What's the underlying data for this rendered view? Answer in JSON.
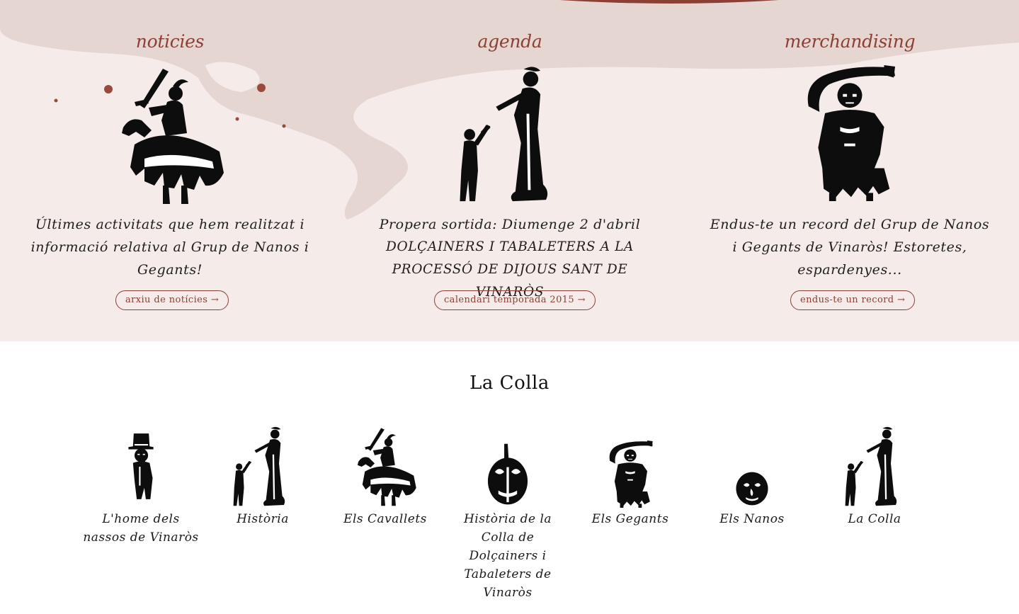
{
  "features": [
    {
      "title": "noticies",
      "figure": "knight-horse-icon",
      "text": "Últimes activitats que hem realitzat i informació relativa al Grup de Nanos i Gegants!",
      "button": "arxiu de notícies →"
    },
    {
      "title": "agenda",
      "figure": "musician-child-icon",
      "text_line1": "Propera sortida: Diumenge 2 d'abril",
      "text_line2": "DOLÇAINERS I TABALETERS A LA PROCESSÓ DE DIJOUS SANT DE VINARÒS",
      "button": "calendari temporada 2015 →"
    },
    {
      "title": "merchandising",
      "figure": "giant-scarf-icon",
      "text": "Endus-te un record del Grup de Nanos i Gegants de Vinaròs! Estoretes, espardenyes...",
      "button": "endus-te un record →"
    }
  ],
  "colla": {
    "title": "La Colla",
    "items": [
      {
        "label": "L'home dels nassos de Vinaròs",
        "icon": "top-hat-man-icon"
      },
      {
        "label": "Història",
        "icon": "musician-child-icon"
      },
      {
        "label": "Els Cavallets",
        "icon": "knight-horse-icon"
      },
      {
        "label": "Història de la Colla de Dolçainers i Tabaleters de Vinaròs",
        "icon": "drum-icon"
      },
      {
        "label": "Els Gegants",
        "icon": "giant-scarf-icon"
      },
      {
        "label": "Els Nanos",
        "icon": "nano-head-icon"
      },
      {
        "label": "La Colla",
        "icon": "musician-child-icon"
      }
    ]
  },
  "colors": {
    "accent": "#8b4036",
    "band_bg": "#f5ebe8",
    "splash": "#e3d2cd",
    "ink": "#0d0d0d"
  }
}
